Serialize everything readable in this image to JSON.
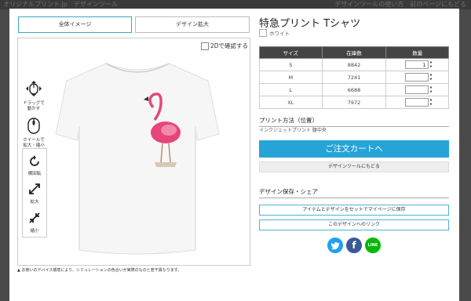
{
  "background": {
    "left_text": "オリジナルプリント.jp　デザインツール",
    "right_text": "デザインツールの使い方　前のページにもどる"
  },
  "tabs": {
    "whole": "全体イメージ",
    "zoom": "デザイン拡大"
  },
  "canvas": {
    "check_2d_label": "2Dで確認する"
  },
  "tools": {
    "drag_label": "ドラッグで\n動かす",
    "wheel_label": "ホイールで\n拡大・縮小",
    "rotate_label": "横回転",
    "zoom_in_label": "拡大",
    "zoom_out_label": "縮小"
  },
  "notice": "お使いのデバイス環境により、シミュレーションの色合いが実際のものと若干異なります。",
  "product": {
    "title": "特急プリント Tシャツ",
    "color": "ホワイト"
  },
  "size_table": {
    "headers": [
      "サイズ",
      "在庫数",
      "数量"
    ],
    "rows": [
      {
        "size": "S",
        "stock": "8842",
        "qty": "1"
      },
      {
        "size": "M",
        "stock": "7241",
        "qty": ""
      },
      {
        "size": "L",
        "stock": "6688",
        "qty": ""
      },
      {
        "size": "XL",
        "stock": "7972",
        "qty": ""
      }
    ]
  },
  "print_section": {
    "heading": "プリント方法（位置）",
    "method": "インクジェットプリント 腰中央"
  },
  "buttons": {
    "cart": "ご注文カートへ",
    "return_to_tool": "デザインツールにもどる",
    "save_mypage": "アイテムとデザインをセットでマイページに保存",
    "design_link": "このデザインへのリンク"
  },
  "save_section": {
    "heading": "デザイン保存・シェア"
  },
  "social": {
    "twitter": "twitter-icon",
    "facebook_glyph": "f",
    "line_label": "LINE"
  },
  "colors": {
    "accent": "#26a4d8",
    "table_header": "#444444",
    "twitter": "#1da1f2",
    "facebook": "#3b5998",
    "line": "#00b900"
  }
}
